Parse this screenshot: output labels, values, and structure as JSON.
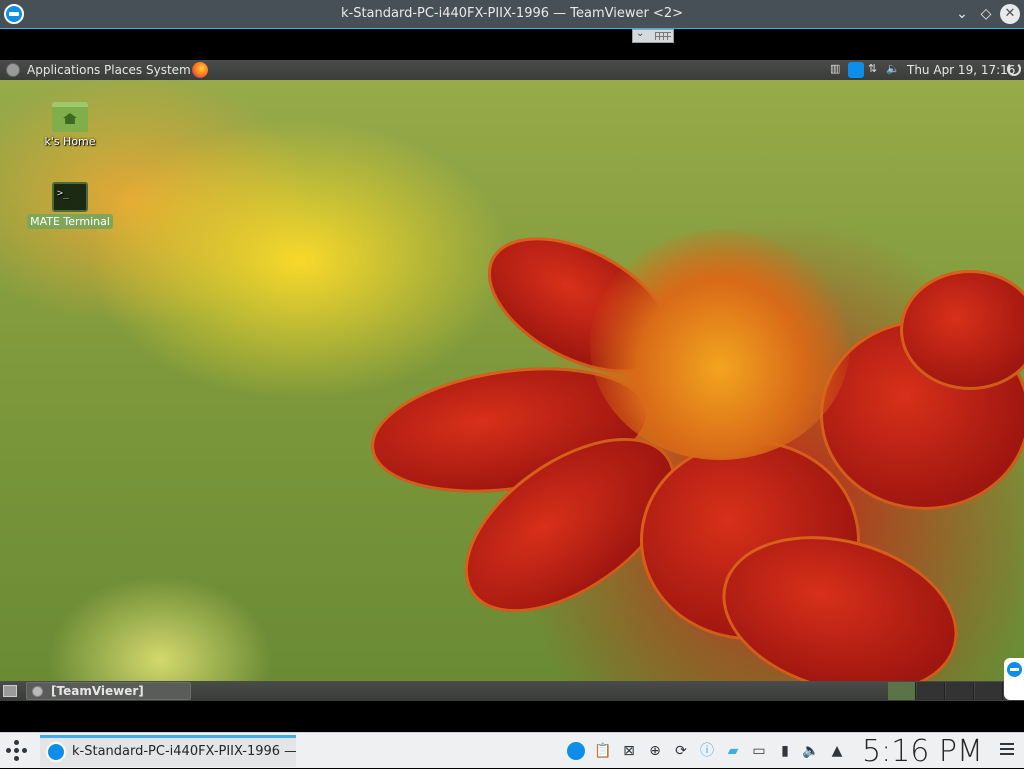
{
  "host_window": {
    "title": "k-Standard-PC-i440FX-PIIX-1996 — TeamViewer <2>",
    "controls": {
      "minimize": "⌄",
      "maximize": "◇",
      "close": "✕"
    }
  },
  "remote_desktop": {
    "top_panel": {
      "menus": [
        "Applications",
        "Places",
        "System"
      ],
      "clock": "Thu Apr 19, 17:16"
    },
    "desktop_icons": [
      {
        "label": "k's Home",
        "icon": "home-folder-icon"
      },
      {
        "label": "MATE Terminal",
        "icon": "terminal-icon",
        "selected": true
      }
    ],
    "terminal_prompt": ">_",
    "bottom_panel": {
      "task_label": "[TeamViewer]",
      "workspaces": 4,
      "active_workspace": 1
    }
  },
  "host_taskbar": {
    "task_label": "k-Standard-PC-i440FX-PIIX-1996 —...",
    "clock": "5:16 PM",
    "tray_icons": [
      "teamviewer-icon",
      "clipboard-icon",
      "screenshot-icon",
      "update-icon",
      "sync-icon",
      "info-icon",
      "chat-icon",
      "network-icon",
      "usb-icon",
      "volume-icon",
      "expand-tray-icon"
    ]
  }
}
